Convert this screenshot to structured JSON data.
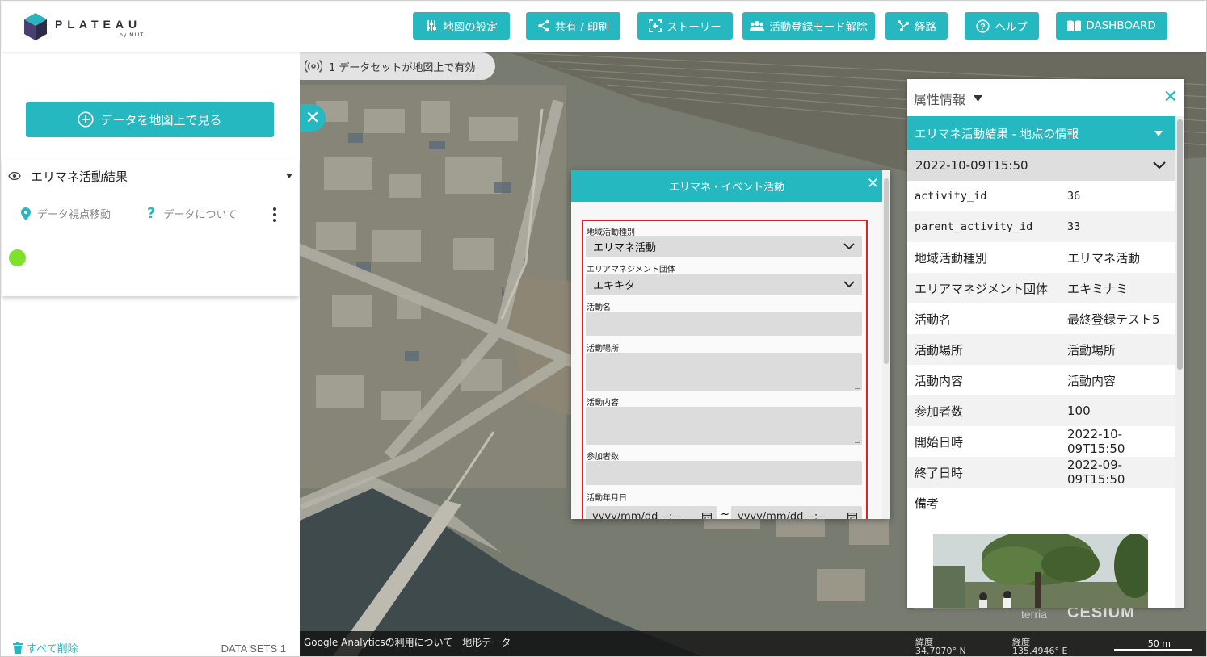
{
  "header": {
    "logo_text": "PLATEAU",
    "logo_sub": "by MLIT",
    "buttons": {
      "map_settings": "地図の設定",
      "share_print": "共有 / 印刷",
      "story": "ストーリー",
      "activity_mode": "活動登録モード解除",
      "route": "経路",
      "help": "ヘルプ",
      "dashboard": "DASHBOARD"
    }
  },
  "sidebar": {
    "view_data_button": "データを地図上で見る",
    "dataset": {
      "name": "エリマネ活動結果",
      "move_view": "データ視点移動",
      "about": "データについて",
      "legend_color": "#7ee22a"
    },
    "remove_all": "すべて削除",
    "datasets_count": "DATA SETS 1"
  },
  "map": {
    "dataset_status": "1 データセットが地図上で有効",
    "footer": {
      "analytics_link": "Google Analyticsの利用について",
      "terrain_link": "地形データ",
      "lat_label": "緯度",
      "lat_value": "34.7070° N",
      "lon_label": "経度",
      "lon_value": "135.4946° E",
      "scale": "50 m"
    },
    "terria": "terria",
    "cesium": "CESIUM"
  },
  "event_form": {
    "title": "エリマネ・イベント活動",
    "fields": {
      "activity_type_label": "地域活動種別",
      "activity_type_value": "エリマネ活動",
      "org_label": "エリアマネジメント団体",
      "org_value": "エキキタ",
      "name_label": "活動名",
      "place_label": "活動場所",
      "content_label": "活動内容",
      "participants_label": "参加者数",
      "date_label": "活動年月日",
      "date_start_placeholder": "yyyy/mm/dd --:--",
      "date_tilde": "~",
      "date_end_placeholder": "yyyy/mm/dd --:--"
    }
  },
  "attributes": {
    "title": "属性情報",
    "bar_title": "エリマネ活動結果 - 地点の情報",
    "timestamp": "2022-10-09T15:50",
    "rows": [
      {
        "key": "activity_id",
        "value": "36"
      },
      {
        "key": "parent_activity_id",
        "value": "33"
      },
      {
        "key": "地域活動種別",
        "value": "エリマネ活動"
      },
      {
        "key": "エリアマネジメント団体",
        "value": "エキミナミ"
      },
      {
        "key": "活動名",
        "value": "最終登録テスト5"
      },
      {
        "key": "活動場所",
        "value": "活動場所"
      },
      {
        "key": "活動内容",
        "value": "活動内容"
      },
      {
        "key": "参加者数",
        "value": "100"
      },
      {
        "key": "開始日時",
        "value": "2022-10-09T15:50"
      },
      {
        "key": "終了日時",
        "value": "2022-09-09T15:50"
      },
      {
        "key": "備考",
        "value": ""
      }
    ]
  },
  "colors": {
    "accent": "#26b8c0",
    "highlight_border": "#e41e1e"
  }
}
